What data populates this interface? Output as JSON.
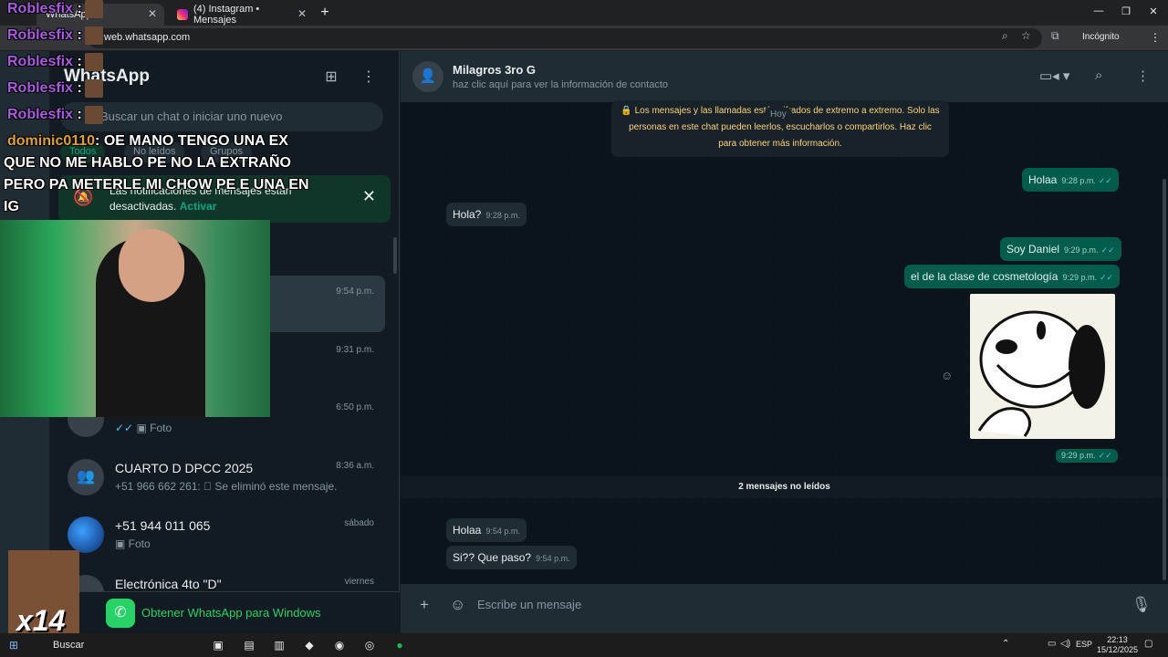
{
  "browser": {
    "active_tab": "WhatsApp",
    "other_tab": "(4) Instagram • Mensajes",
    "url": "web.whatsapp.com",
    "incognito_label": "Incógnito"
  },
  "sidebar": {
    "title": "WhatsApp",
    "search_placeholder": "Buscar un chat o iniciar uno nuevo",
    "filters": [
      "Todos",
      "No leídos",
      "Grupos"
    ],
    "notification": {
      "text": "Las notificaciones de mensajes están desactivadas.",
      "link": "Activar"
    },
    "chats": [
      {
        "name": "",
        "preview": "",
        "time": "9:54 p.m."
      },
      {
        "name": "",
        "preview": "",
        "time": "9:31 p.m."
      },
      {
        "name": "",
        "preview": "Foto",
        "time": "6:50 p.m."
      },
      {
        "name": "CUARTO D DPCC 2025",
        "preview": "+51 966 662 261: ⃠ Se eliminó este mensaje.",
        "time": "8:36 a.m."
      },
      {
        "name": "+51 944 011 065",
        "preview": "Foto",
        "time": "sábado"
      },
      {
        "name": "Electrónica 4to \"D\"",
        "preview": "",
        "time": "viernes"
      }
    ],
    "get_app": "Obtener WhatsApp para Windows"
  },
  "chat": {
    "contact_name": "Milagros 3ro G",
    "contact_sub": "haz clic aquí para ver la información de contacto",
    "e2e_notice": "Los mensajes y las llamadas están cifrados de extremo a extremo. Solo las personas en este chat pueden leerlos, escucharlos o compartirlos. Haz clic para obtener más información.",
    "day_label": "Hoy",
    "messages": [
      {
        "dir": "out",
        "text": "Holaa",
        "time": "9:28 p.m."
      },
      {
        "dir": "in",
        "text": "Hola?",
        "time": "9:28 p.m."
      },
      {
        "dir": "out",
        "text": "Soy Daniel",
        "time": "9:29 p.m."
      },
      {
        "dir": "out",
        "text": "el de la clase de cosmetología",
        "time": "9:29 p.m."
      },
      {
        "dir": "out",
        "text": "",
        "time": "9:29 p.m."
      },
      {
        "dir": "in",
        "text": "Holaa",
        "time": "9:54 p.m."
      },
      {
        "dir": "in",
        "text": "Si??  Que paso?",
        "time": "9:54 p.m."
      }
    ],
    "unread_divider": "2 mensajes no leídos",
    "composer_placeholder": "Escribe un mensaje"
  },
  "overlay": {
    "chat_lines": [
      {
        "user": "Roblesfix",
        "msg": ":"
      },
      {
        "user": "Roblesfix",
        "msg": ":"
      },
      {
        "user": "Roblesfix",
        "msg": ":"
      },
      {
        "user": "Roblesfix",
        "msg": ":"
      },
      {
        "user": "Roblesfix",
        "msg": ":"
      }
    ],
    "highlight_user": "dominic0110",
    "highlight_msg_1": ": OE MANO TENGO UNA EX",
    "highlight_msg_2": "QUE NO ME HABLO PE NO LA EXTRAÑO",
    "highlight_msg_3": "PERO PA METERLE MI CHOW PE E UNA EN",
    "highlight_msg_4": "IG",
    "emote_count": "x14"
  },
  "taskbar": {
    "search": "Buscar",
    "lang": "ESP",
    "time": "22:13",
    "date": "15/12/2025"
  },
  "colors": {
    "accent": "#00a884",
    "outgoing_bubble": "#005c4b",
    "incoming_bubble": "#202c33",
    "e2e_text": "#ffd279"
  }
}
